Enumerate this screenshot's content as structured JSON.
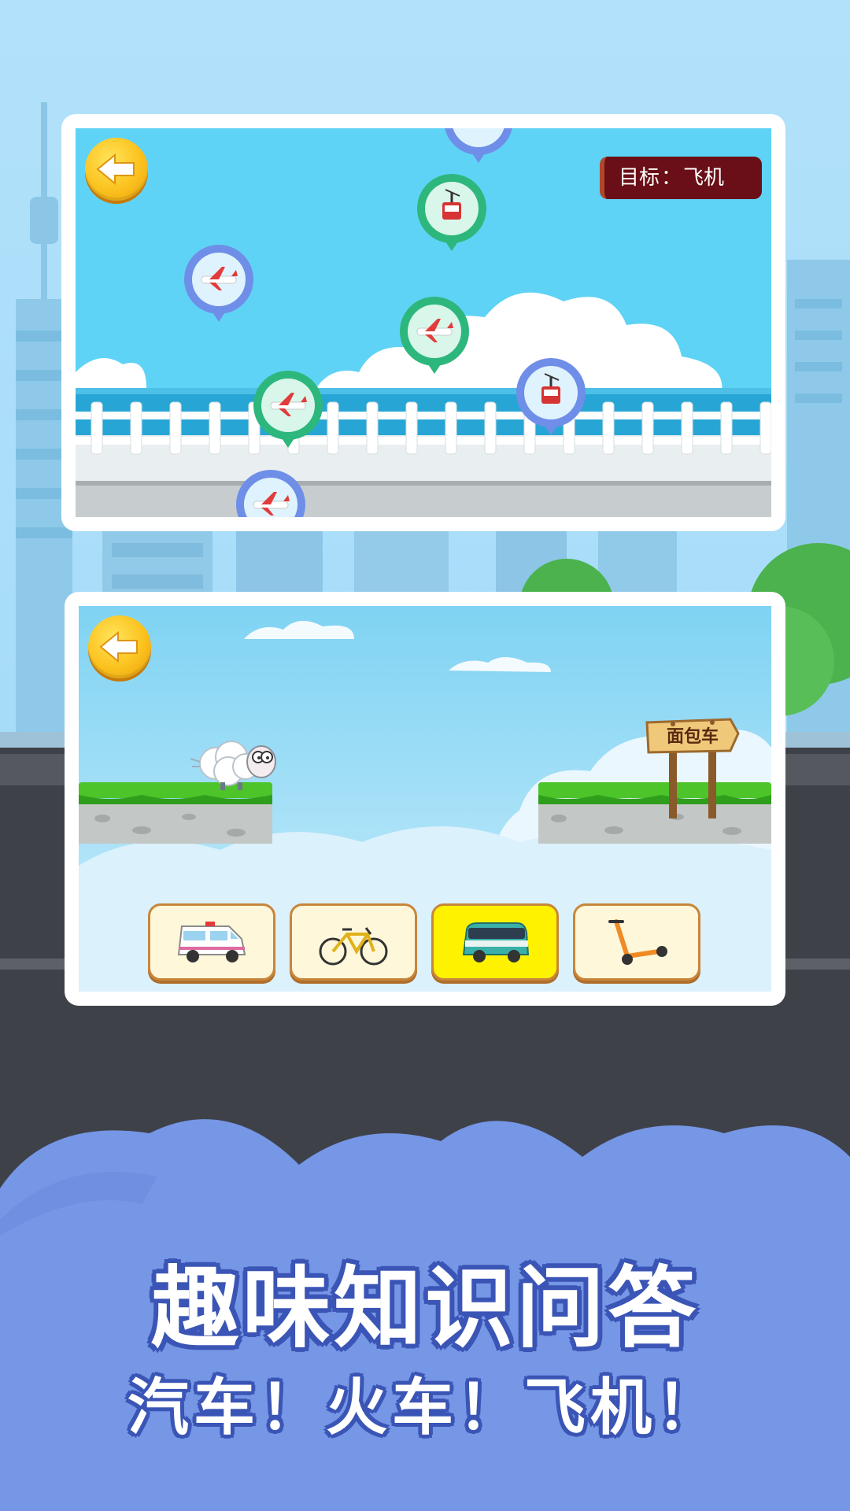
{
  "colors": {
    "sky": "#b2e1fb",
    "road": "#3e4148",
    "cloud_base": "#7696e6",
    "title_outline": "#3a55b5",
    "goal_badge": "#6a0e17",
    "selected_option": "#fff200",
    "grass": "#4cc42a"
  },
  "balloon_game": {
    "back_button_icon": "arrow-left-icon",
    "goal_label": "目标",
    "goal_separator": "：",
    "goal_value": "飞机",
    "balloons": [
      {
        "color": "blue",
        "icon": "airplane-icon"
      },
      {
        "color": "green",
        "icon": "cable-car-icon"
      },
      {
        "color": "green",
        "icon": "airplane-icon"
      },
      {
        "color": "green",
        "icon": "airplane-icon"
      },
      {
        "color": "blue",
        "icon": "cable-car-icon"
      },
      {
        "color": "blue",
        "icon": "airplane-icon"
      },
      {
        "color": "blue",
        "icon": "none"
      }
    ]
  },
  "jump_game": {
    "back_button_icon": "arrow-left-icon",
    "character_icon": "sheep-icon",
    "sign_text": "面包车",
    "options": [
      {
        "icon": "ambulance-icon",
        "selected": false
      },
      {
        "icon": "bicycle-icon",
        "selected": false
      },
      {
        "icon": "van-icon",
        "selected": true
      },
      {
        "icon": "scooter-icon",
        "selected": false
      }
    ]
  },
  "promo": {
    "title": "趣味知识问答",
    "subtitle": "汽车！火车！飞机！"
  }
}
